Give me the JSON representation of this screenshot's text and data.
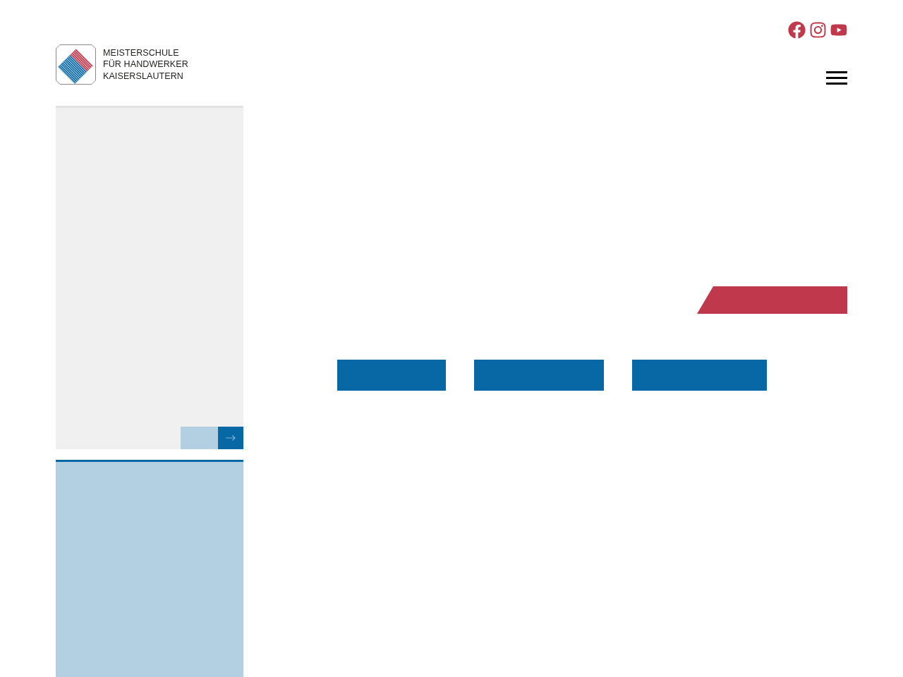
{
  "header": {
    "logo": {
      "lines": [
        "MEISTERSCHULE",
        "FÜR HANDWERKER",
        "KAISERSLAUTERN"
      ]
    },
    "social_links": [
      {
        "kind": "facebook"
      },
      {
        "kind": "instagram"
      },
      {
        "kind": "youtube"
      }
    ]
  }
}
